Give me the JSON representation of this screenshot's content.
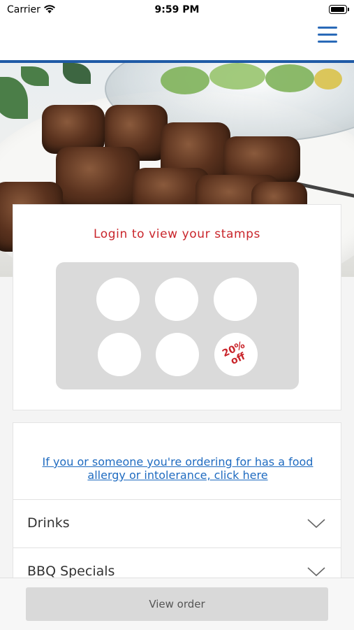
{
  "status_bar": {
    "carrier": "Carrier",
    "time": "9:59 PM"
  },
  "header": {
    "menu_icon": "hamburger-icon",
    "accent_color": "#1f5aa6"
  },
  "stamps": {
    "title": "Login to view your stamps",
    "reward_line1": "20%",
    "reward_line2": "off",
    "title_color": "#c9252b"
  },
  "menu": {
    "allergy_link": "If you or someone you're ordering for has a food allergy or intolerance, click here",
    "categories": [
      {
        "label": "Drinks"
      },
      {
        "label": "BBQ Specials"
      }
    ]
  },
  "footer": {
    "view_order_label": "View order"
  }
}
